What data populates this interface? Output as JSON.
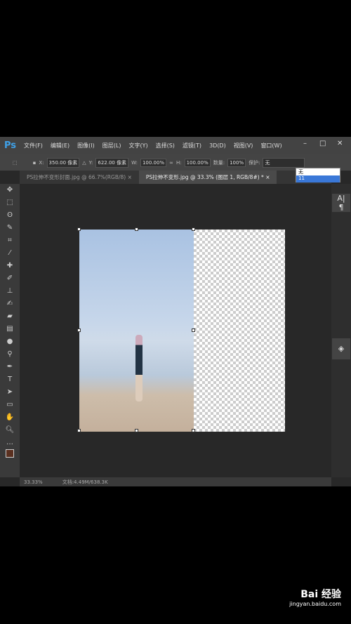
{
  "app": {
    "logo": "Ps",
    "menu": [
      "文件(F)",
      "编辑(E)",
      "图像(I)",
      "图层(L)",
      "文字(Y)",
      "选择(S)",
      "滤镜(T)",
      "3D(D)",
      "视图(V)",
      "窗口(W)"
    ]
  },
  "options": {
    "x_label": "X:",
    "x": "350.00 像素",
    "y_label": "Y:",
    "y": "622.00 像素",
    "w_label": "W:",
    "w": "100.00%",
    "h_label": "H:",
    "h": "100.00%",
    "amount_label": "数量:",
    "amount": "100%",
    "protect_label": "保护:",
    "protect_value": "无"
  },
  "dropdown": {
    "options": [
      "无",
      "11"
    ],
    "selected": "11"
  },
  "tabs": [
    {
      "label": "PS拉伸不变形封面.jpg @ 66.7%(RGB/8)",
      "close": "×"
    },
    {
      "label": "PS拉伸不变形.jpg @ 33.3% (图层 1, RGB/8#) *",
      "close": "×"
    }
  ],
  "status": {
    "zoom": "33.33%",
    "doc": "文档:4.49M/638.3K"
  },
  "watermark": {
    "brand": "Bai 经验",
    "url": "jingyan.baidu.com"
  }
}
